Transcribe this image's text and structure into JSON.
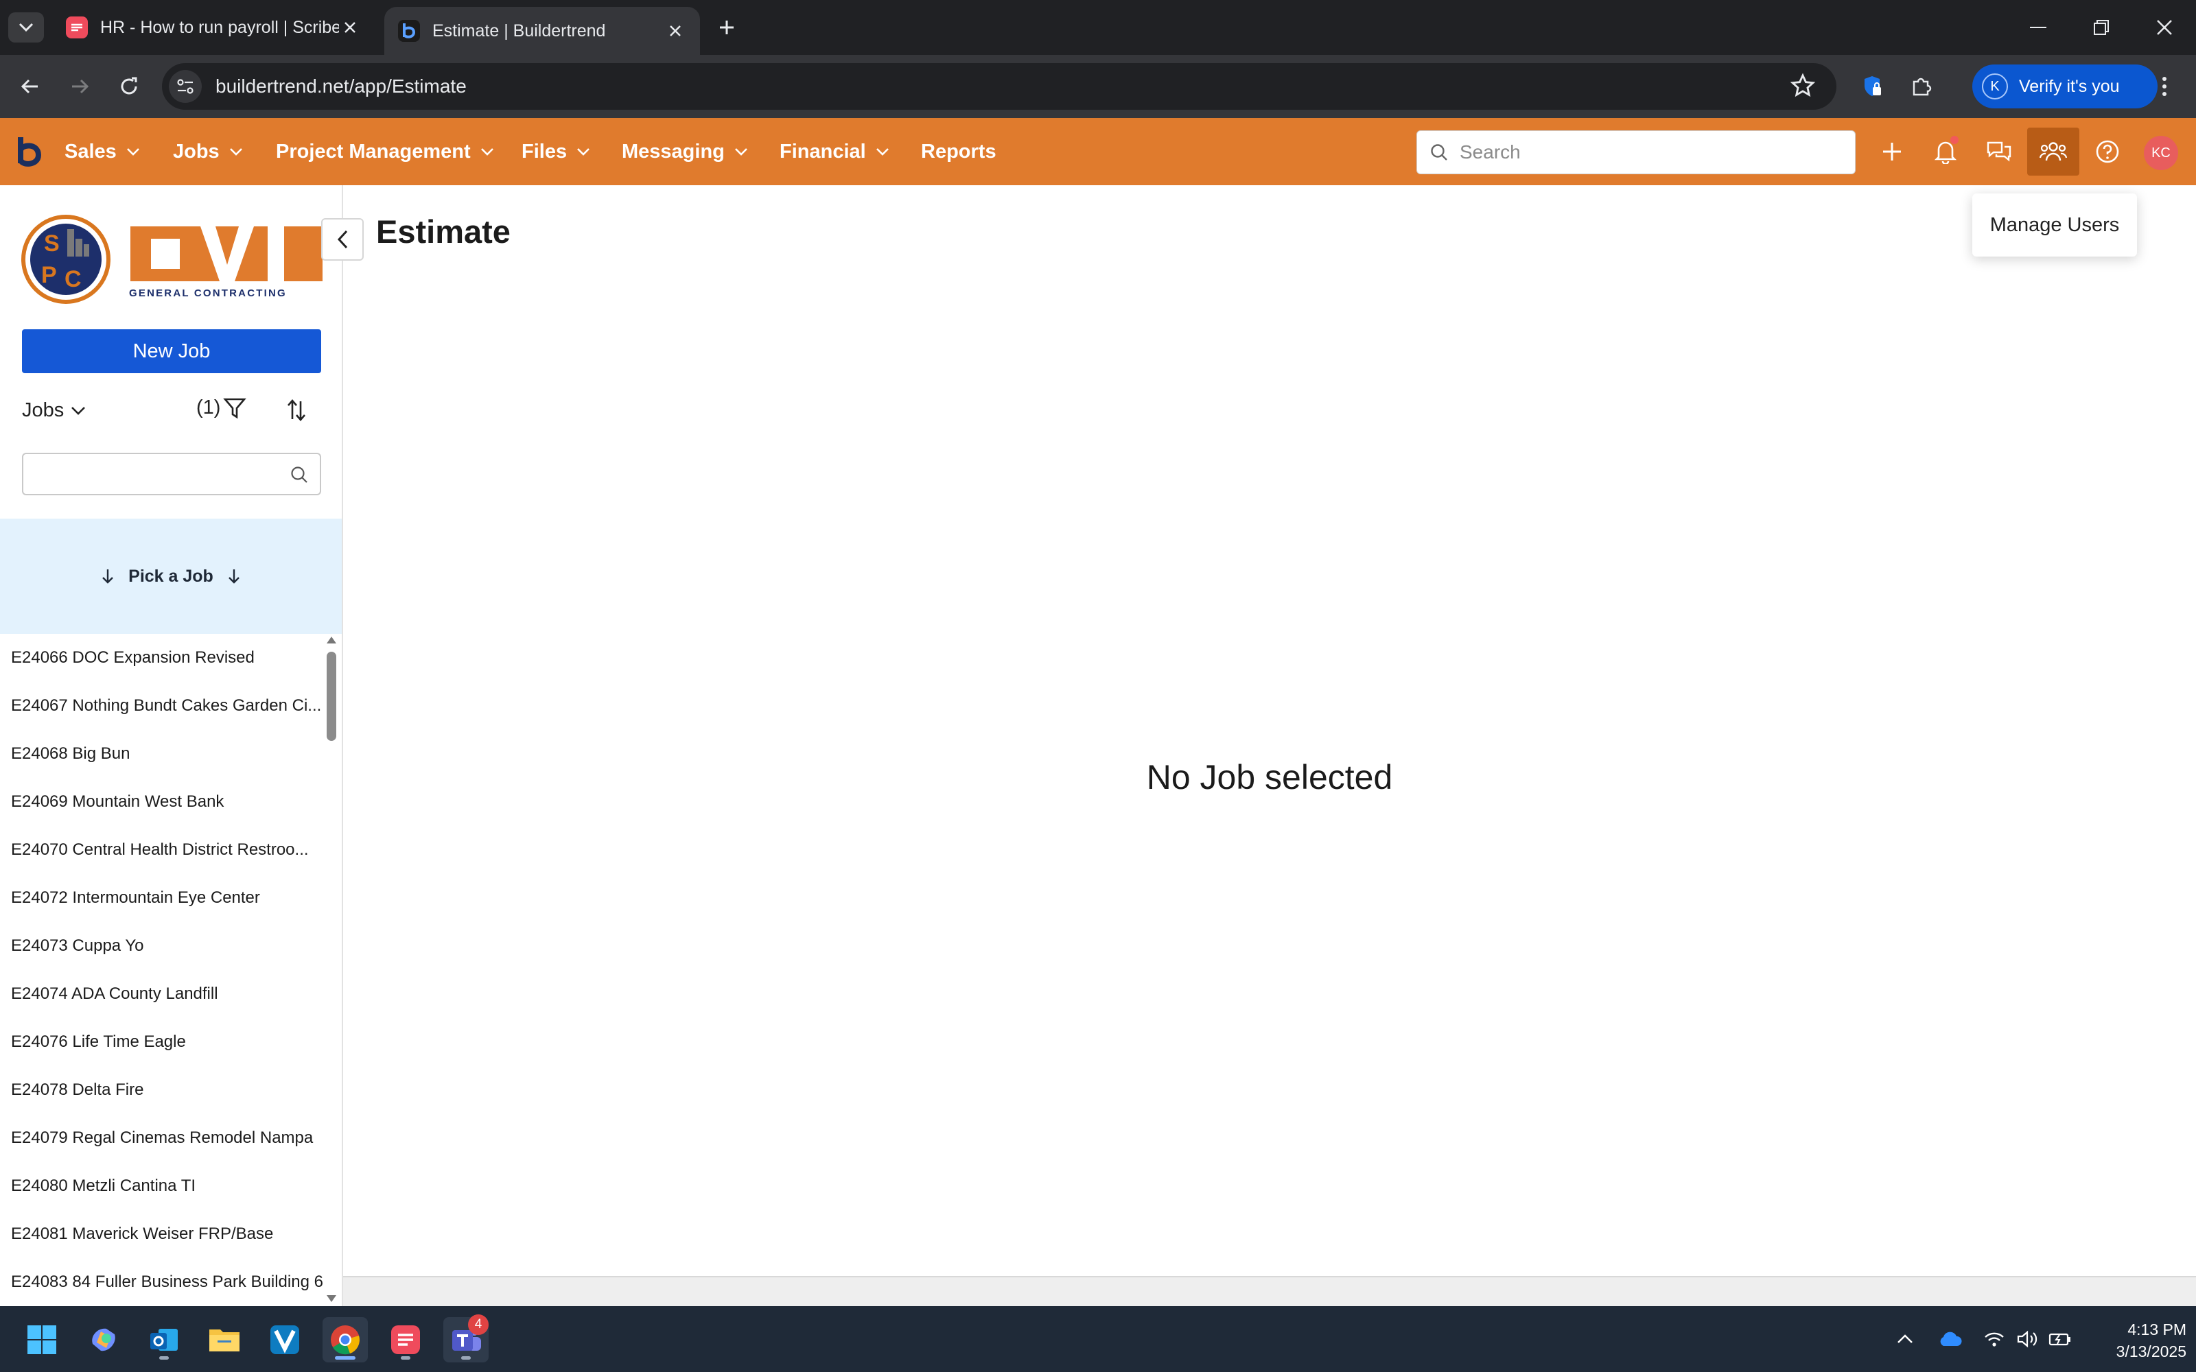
{
  "browser": {
    "tabs": [
      {
        "title": "HR - How to run payroll | Scribe",
        "active": false
      },
      {
        "title": "Estimate | Buildertrend",
        "active": true
      }
    ],
    "address": "buildertrend.net/app/Estimate",
    "verify_label": "Verify it's you",
    "profile_initial": "K"
  },
  "nav": {
    "menus": [
      {
        "label": "Sales",
        "dropdown": true
      },
      {
        "label": "Jobs",
        "dropdown": true
      },
      {
        "label": "Project Management",
        "dropdown": true
      },
      {
        "label": "Files",
        "dropdown": true
      },
      {
        "label": "Messaging",
        "dropdown": true
      },
      {
        "label": "Financial",
        "dropdown": true
      },
      {
        "label": "Reports",
        "dropdown": false
      }
    ],
    "search_placeholder": "Search",
    "avatar_initials": "KC",
    "tooltip": "Manage Users",
    "accent_color": "#e07b2d"
  },
  "sidebar": {
    "logo_text": "OVI",
    "logo_subtitle": "GENERAL CONTRACTING",
    "logo_seal": "SPC",
    "new_job_label": "New Job",
    "jobs_dropdown_label": "Jobs",
    "filter_count": "(1)",
    "pick_job_label": "Pick a Job",
    "jobs": [
      "E24066 DOC Expansion Revised",
      "E24067 Nothing Bundt Cakes Garden Ci...",
      "E24068 Big Bun",
      "E24069 Mountain West Bank",
      "E24070 Central Health District Restroo...",
      "E24072 Intermountain Eye Center",
      "E24073 Cuppa Yo",
      "E24074 ADA County Landfill",
      "E24076 Life Time Eagle",
      "E24078 Delta Fire",
      "E24079 Regal Cinemas Remodel Nampa",
      "E24080 Metzli Cantina TI",
      "E24081 Maverick Weiser FRP/Base",
      "E24083 84 Fuller Business Park Building 6"
    ]
  },
  "main": {
    "title": "Estimate",
    "empty_message": "No Job selected"
  },
  "taskbar": {
    "teams_badge": "4",
    "time": "4:13 PM",
    "date": "3/13/2025"
  }
}
